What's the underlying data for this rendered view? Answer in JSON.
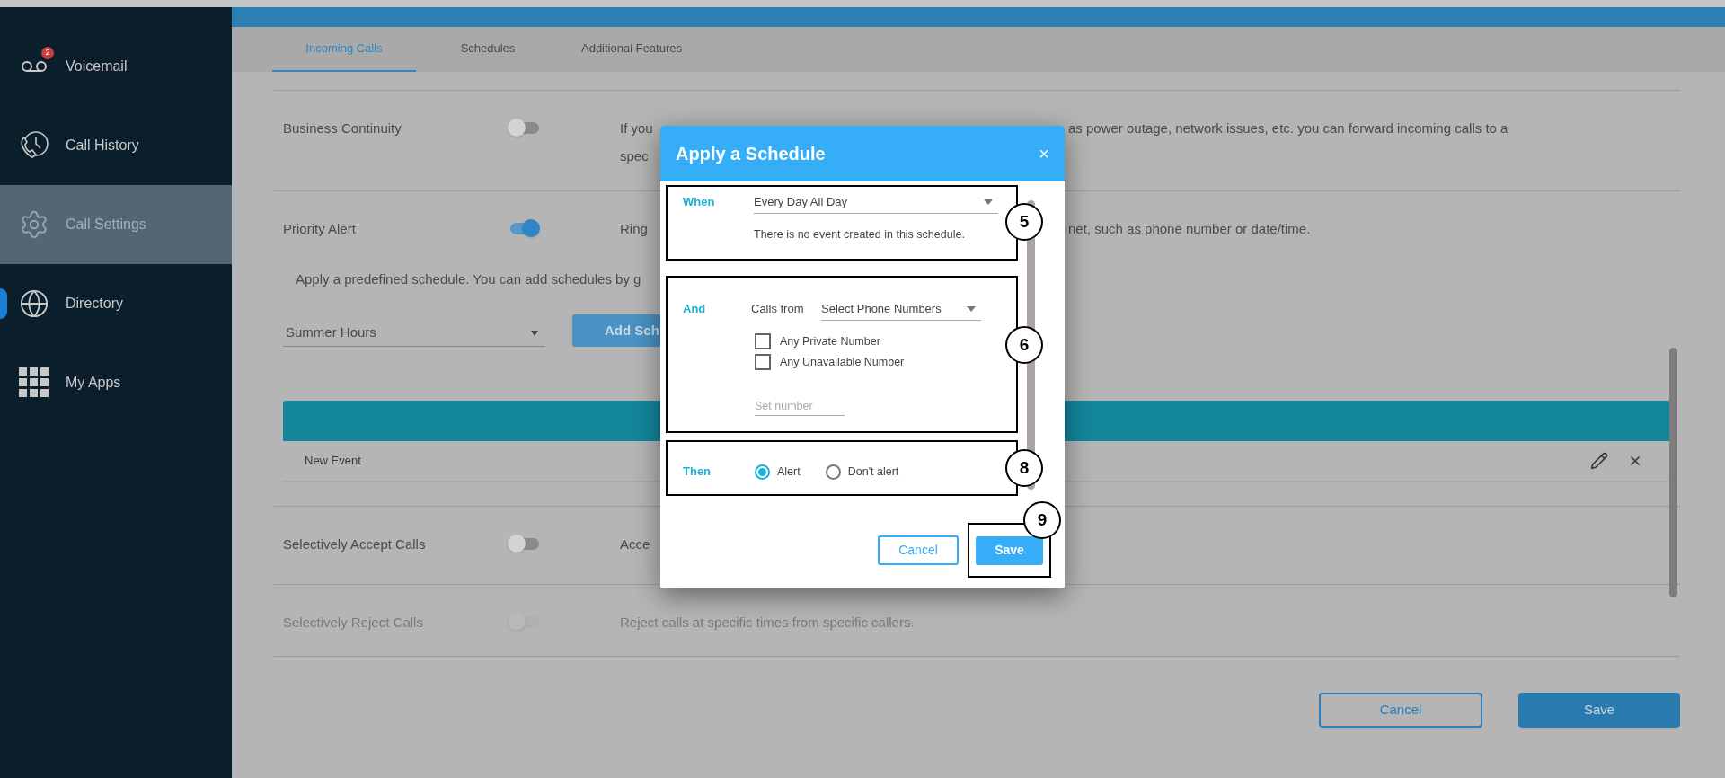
{
  "sidebar": {
    "items": [
      {
        "label": "Voicemail",
        "badge": "2",
        "selected": false
      },
      {
        "label": "Call History",
        "selected": false
      },
      {
        "label": "Call Settings",
        "selected": true
      },
      {
        "label": "Directory",
        "handle": true,
        "selected": false
      },
      {
        "label": "My Apps",
        "selected": false
      }
    ]
  },
  "tabs": [
    {
      "label": "Incoming Calls",
      "selected": true
    },
    {
      "label": "Schedules",
      "selected": false
    },
    {
      "label": "Additional Features",
      "selected": false
    }
  ],
  "settings": [
    {
      "label": "Business Continuity",
      "on": false,
      "disabled": false,
      "description_left": [
        "If you",
        "spec"
      ],
      "description_right": "as power outage, network issues, etc. you can forward incoming calls to a"
    },
    {
      "label": "Priority Alert",
      "on": true,
      "disabled": false,
      "description_left": [
        "Ring"
      ],
      "description_right": "net, such as phone number or date/time.",
      "schedule": {
        "hint": "Apply a predefined schedule. You can add schedules by g",
        "dropdown": "Summer Hours",
        "button": "Add Sch",
        "rows": [
          {
            "name": "New Event"
          }
        ]
      }
    },
    {
      "label": "Selectively Accept Calls",
      "on": false,
      "disabled": false,
      "description_left": [
        "Acce"
      ]
    },
    {
      "label": "Selectively Reject Calls",
      "on": false,
      "disabled": true,
      "description_left": [
        "Reject calls at specific times from specific callers."
      ]
    }
  ],
  "footer": {
    "cancel": "Cancel",
    "save": "Save"
  },
  "modal": {
    "title": "Apply a Schedule",
    "close": "×",
    "when": {
      "label": "When",
      "value": "Every Day All Day",
      "note": "There is no event created in this schedule."
    },
    "and": {
      "label": "And",
      "calls_from": "Calls from",
      "value": "Select Phone Numbers",
      "options": [
        {
          "label": "Any Private Number",
          "checked": false
        },
        {
          "label": "Any Unavailable Number",
          "checked": false
        }
      ],
      "number": {
        "placeholder": "Set number"
      }
    },
    "then": {
      "label": "Then",
      "options": [
        {
          "label": "Alert",
          "selected": true
        },
        {
          "label": "Don't alert",
          "selected": false
        }
      ]
    },
    "cancel": "Cancel",
    "save": "Save"
  },
  "annotations": [
    "5",
    "6",
    "8",
    "9"
  ]
}
